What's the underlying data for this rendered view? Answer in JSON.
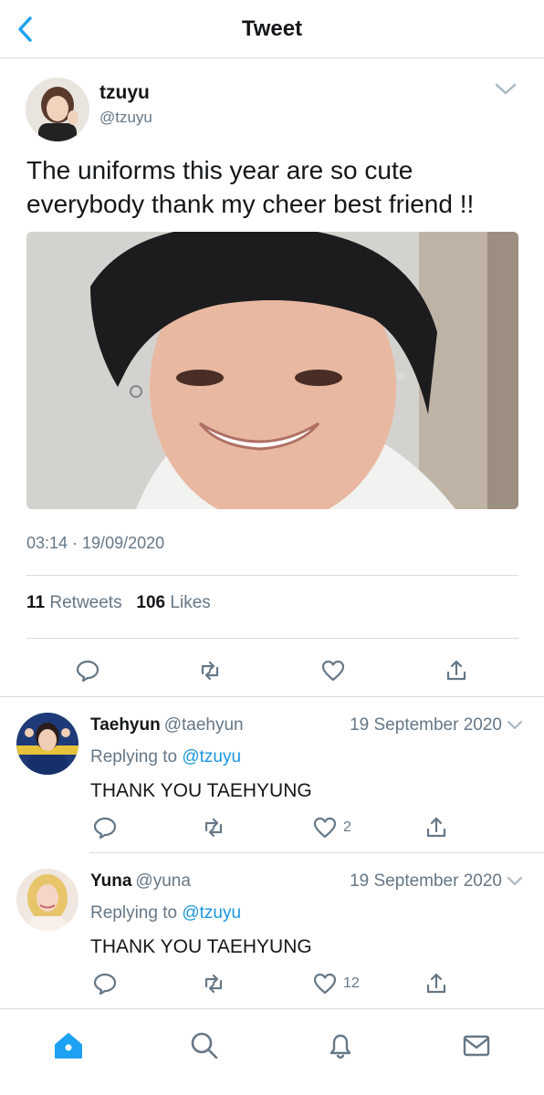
{
  "header": {
    "title": "Tweet",
    "back_icon": "chevron-left-icon",
    "accent": "#1da1f2"
  },
  "tweet": {
    "author_name": "tzuyu",
    "author_handle": "@tzuyu",
    "text": "The uniforms this year are so cute everybody thank my cheer best friend !!",
    "timestamp": "03:14 · 19/09/2020",
    "retweets_count": "11",
    "retweets_label": "Retweets",
    "likes_count": "106",
    "likes_label": "Likes"
  },
  "replies": [
    {
      "name": "Taehyun",
      "handle": "@taehyun",
      "date": "19 September 2020",
      "replying_prefix": "Replying to",
      "replying_to": "@tzuyu",
      "text": "THANK YOU TAEHYUNG",
      "likes": "2"
    },
    {
      "name": "Yuna",
      "handle": "@yuna",
      "date": "19 September 2020",
      "replying_prefix": "Replying to",
      "replying_to": "@tzuyu",
      "text": "THANK YOU TAEHYUNG",
      "likes": "12"
    }
  ],
  "tabbar": {
    "active_color": "#1da1f2",
    "inactive_color": "#657786",
    "items": [
      "home-icon",
      "search-icon",
      "notifications-icon",
      "messages-icon"
    ]
  }
}
